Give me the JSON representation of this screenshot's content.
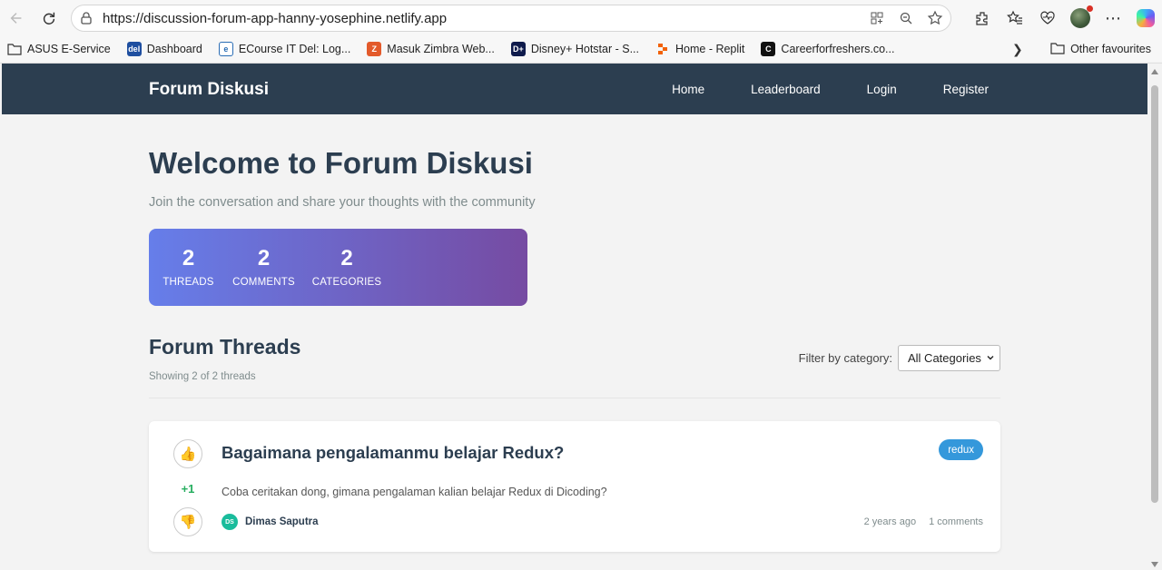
{
  "browser": {
    "url": "https://discussion-forum-app-hanny-yosephine.netlify.app",
    "bookmarks": [
      {
        "label": "ASUS E-Service",
        "icon": "folder-icon"
      },
      {
        "label": "Dashboard",
        "icon": "del-icon"
      },
      {
        "label": "ECourse IT Del: Log...",
        "icon": "ecourse-icon"
      },
      {
        "label": "Masuk Zimbra Web...",
        "icon": "zimbra-icon"
      },
      {
        "label": "Disney+ Hotstar - S...",
        "icon": "hotstar-icon"
      },
      {
        "label": "Home - Replit",
        "icon": "replit-icon"
      },
      {
        "label": "Careerforfreshers.co...",
        "icon": "c-icon"
      }
    ],
    "other_favourites": "Other favourites"
  },
  "nav": {
    "brand": "Forum Diskusi",
    "links": [
      "Home",
      "Leaderboard",
      "Login",
      "Register"
    ]
  },
  "hero": {
    "title": "Welcome to Forum Diskusi",
    "subtitle": "Join the conversation and share your thoughts with the community",
    "stats": [
      {
        "value": "2",
        "label": "THREADS"
      },
      {
        "value": "2",
        "label": "COMMENTS"
      },
      {
        "value": "2",
        "label": "CATEGORIES"
      }
    ]
  },
  "threads_section": {
    "title": "Forum Threads",
    "count_text": "Showing 2 of 2 threads",
    "filter_label": "Filter by category:",
    "filter_value": "All Categories"
  },
  "threads": [
    {
      "title": "Bagaimana pengalamanmu belajar Redux?",
      "body": "Coba ceritakan dong, gimana pengalaman kalian belajar Redux di Dicoding?",
      "category": "redux",
      "votes": "+1",
      "author_initials": "DS",
      "author": "Dimas Saputra",
      "time": "2 years ago",
      "comments": "1 comments"
    }
  ],
  "colors": {
    "nav_bg": "#2c3e50",
    "gradient_start": "#667eea",
    "gradient_end": "#764ba2",
    "badge": "#3498db",
    "vote_positive": "#27ae60"
  }
}
